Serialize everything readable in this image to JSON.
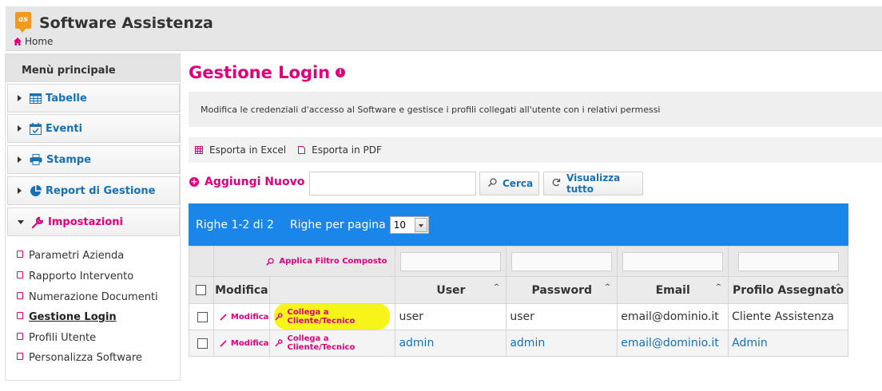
{
  "app": {
    "logo_text": "as",
    "title": "Software Assistenza",
    "breadcrumb": "Home"
  },
  "sidebar": {
    "header": "Menù principale",
    "sections": [
      {
        "label": "Tabelle",
        "icon": "table-icon"
      },
      {
        "label": "Eventi",
        "icon": "calendar-icon"
      },
      {
        "label": "Stampe",
        "icon": "printer-icon"
      },
      {
        "label": "Report di Gestione",
        "icon": "pie-chart-icon"
      },
      {
        "label": "Impostazioni",
        "icon": "wrench-icon",
        "expanded": true
      }
    ],
    "sub_items": [
      {
        "label": "Parametri Azienda"
      },
      {
        "label": "Rapporto Intervento"
      },
      {
        "label": "Numerazione Documenti"
      },
      {
        "label": "Gestione Login",
        "current": true
      },
      {
        "label": "Profili Utente"
      },
      {
        "label": "Personalizza Software"
      }
    ]
  },
  "main": {
    "title": "Gestione Login",
    "description": "Modifica le credenziali d'accesso al Software e gestisce i profili collegati all'utente con i relativi permessi",
    "export": {
      "excel": "Esporta in Excel",
      "pdf": "Esporta in PDF"
    },
    "add_new": "Aggiungi Nuovo",
    "search": {
      "value": "",
      "button": "Cerca"
    },
    "show_all": "Visualizza tutto"
  },
  "grid": {
    "rows_info": "Righe 1-2 di 2",
    "rows_per_page_label": "Righe per pagina",
    "rows_per_page_value": "10",
    "filter_link": "Applica Filtro Composto",
    "columns": [
      "Modifica",
      "User",
      "Password",
      "Email",
      "Profilo Assegnato"
    ],
    "rows": [
      {
        "edit": "Modifica",
        "link": "Collega a Cliente/Tecnico",
        "user": "user",
        "password": "user",
        "email": "email@dominio.it",
        "profile": "Cliente Assistenza"
      },
      {
        "edit": "Modifica",
        "link": "Collega a Cliente/Tecnico",
        "user": "admin",
        "password": "admin",
        "email": "email@dominio.it",
        "profile": "Admin"
      }
    ]
  },
  "colors": {
    "accent": "#e0007a",
    "link": "#1670b8",
    "grid_header": "#1a86ea",
    "highlight": "#f6f300",
    "logo": "#f29a1f"
  }
}
